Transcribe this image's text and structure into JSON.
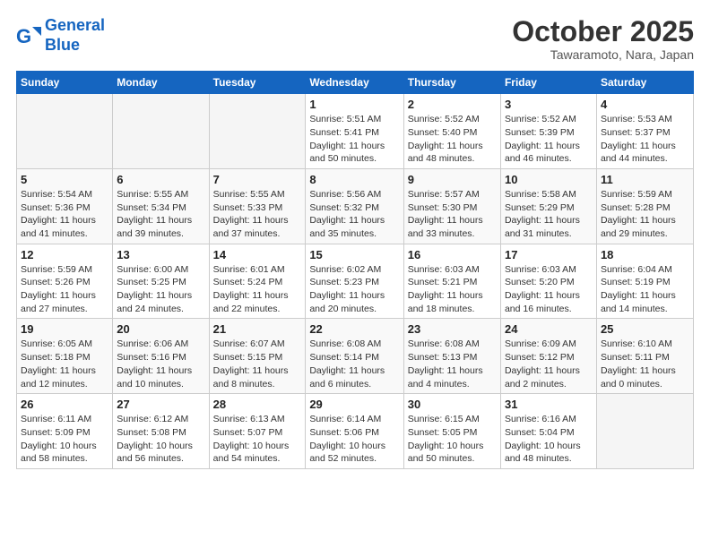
{
  "header": {
    "logo_line1": "General",
    "logo_line2": "Blue",
    "month": "October 2025",
    "location": "Tawaramoto, Nara, Japan"
  },
  "weekdays": [
    "Sunday",
    "Monday",
    "Tuesday",
    "Wednesday",
    "Thursday",
    "Friday",
    "Saturday"
  ],
  "weeks": [
    [
      {
        "day": "",
        "info": ""
      },
      {
        "day": "",
        "info": ""
      },
      {
        "day": "",
        "info": ""
      },
      {
        "day": "1",
        "info": "Sunrise: 5:51 AM\nSunset: 5:41 PM\nDaylight: 11 hours\nand 50 minutes."
      },
      {
        "day": "2",
        "info": "Sunrise: 5:52 AM\nSunset: 5:40 PM\nDaylight: 11 hours\nand 48 minutes."
      },
      {
        "day": "3",
        "info": "Sunrise: 5:52 AM\nSunset: 5:39 PM\nDaylight: 11 hours\nand 46 minutes."
      },
      {
        "day": "4",
        "info": "Sunrise: 5:53 AM\nSunset: 5:37 PM\nDaylight: 11 hours\nand 44 minutes."
      }
    ],
    [
      {
        "day": "5",
        "info": "Sunrise: 5:54 AM\nSunset: 5:36 PM\nDaylight: 11 hours\nand 41 minutes."
      },
      {
        "day": "6",
        "info": "Sunrise: 5:55 AM\nSunset: 5:34 PM\nDaylight: 11 hours\nand 39 minutes."
      },
      {
        "day": "7",
        "info": "Sunrise: 5:55 AM\nSunset: 5:33 PM\nDaylight: 11 hours\nand 37 minutes."
      },
      {
        "day": "8",
        "info": "Sunrise: 5:56 AM\nSunset: 5:32 PM\nDaylight: 11 hours\nand 35 minutes."
      },
      {
        "day": "9",
        "info": "Sunrise: 5:57 AM\nSunset: 5:30 PM\nDaylight: 11 hours\nand 33 minutes."
      },
      {
        "day": "10",
        "info": "Sunrise: 5:58 AM\nSunset: 5:29 PM\nDaylight: 11 hours\nand 31 minutes."
      },
      {
        "day": "11",
        "info": "Sunrise: 5:59 AM\nSunset: 5:28 PM\nDaylight: 11 hours\nand 29 minutes."
      }
    ],
    [
      {
        "day": "12",
        "info": "Sunrise: 5:59 AM\nSunset: 5:26 PM\nDaylight: 11 hours\nand 27 minutes."
      },
      {
        "day": "13",
        "info": "Sunrise: 6:00 AM\nSunset: 5:25 PM\nDaylight: 11 hours\nand 24 minutes."
      },
      {
        "day": "14",
        "info": "Sunrise: 6:01 AM\nSunset: 5:24 PM\nDaylight: 11 hours\nand 22 minutes."
      },
      {
        "day": "15",
        "info": "Sunrise: 6:02 AM\nSunset: 5:23 PM\nDaylight: 11 hours\nand 20 minutes."
      },
      {
        "day": "16",
        "info": "Sunrise: 6:03 AM\nSunset: 5:21 PM\nDaylight: 11 hours\nand 18 minutes."
      },
      {
        "day": "17",
        "info": "Sunrise: 6:03 AM\nSunset: 5:20 PM\nDaylight: 11 hours\nand 16 minutes."
      },
      {
        "day": "18",
        "info": "Sunrise: 6:04 AM\nSunset: 5:19 PM\nDaylight: 11 hours\nand 14 minutes."
      }
    ],
    [
      {
        "day": "19",
        "info": "Sunrise: 6:05 AM\nSunset: 5:18 PM\nDaylight: 11 hours\nand 12 minutes."
      },
      {
        "day": "20",
        "info": "Sunrise: 6:06 AM\nSunset: 5:16 PM\nDaylight: 11 hours\nand 10 minutes."
      },
      {
        "day": "21",
        "info": "Sunrise: 6:07 AM\nSunset: 5:15 PM\nDaylight: 11 hours\nand 8 minutes."
      },
      {
        "day": "22",
        "info": "Sunrise: 6:08 AM\nSunset: 5:14 PM\nDaylight: 11 hours\nand 6 minutes."
      },
      {
        "day": "23",
        "info": "Sunrise: 6:08 AM\nSunset: 5:13 PM\nDaylight: 11 hours\nand 4 minutes."
      },
      {
        "day": "24",
        "info": "Sunrise: 6:09 AM\nSunset: 5:12 PM\nDaylight: 11 hours\nand 2 minutes."
      },
      {
        "day": "25",
        "info": "Sunrise: 6:10 AM\nSunset: 5:11 PM\nDaylight: 11 hours\nand 0 minutes."
      }
    ],
    [
      {
        "day": "26",
        "info": "Sunrise: 6:11 AM\nSunset: 5:09 PM\nDaylight: 10 hours\nand 58 minutes."
      },
      {
        "day": "27",
        "info": "Sunrise: 6:12 AM\nSunset: 5:08 PM\nDaylight: 10 hours\nand 56 minutes."
      },
      {
        "day": "28",
        "info": "Sunrise: 6:13 AM\nSunset: 5:07 PM\nDaylight: 10 hours\nand 54 minutes."
      },
      {
        "day": "29",
        "info": "Sunrise: 6:14 AM\nSunset: 5:06 PM\nDaylight: 10 hours\nand 52 minutes."
      },
      {
        "day": "30",
        "info": "Sunrise: 6:15 AM\nSunset: 5:05 PM\nDaylight: 10 hours\nand 50 minutes."
      },
      {
        "day": "31",
        "info": "Sunrise: 6:16 AM\nSunset: 5:04 PM\nDaylight: 10 hours\nand 48 minutes."
      },
      {
        "day": "",
        "info": ""
      }
    ]
  ]
}
